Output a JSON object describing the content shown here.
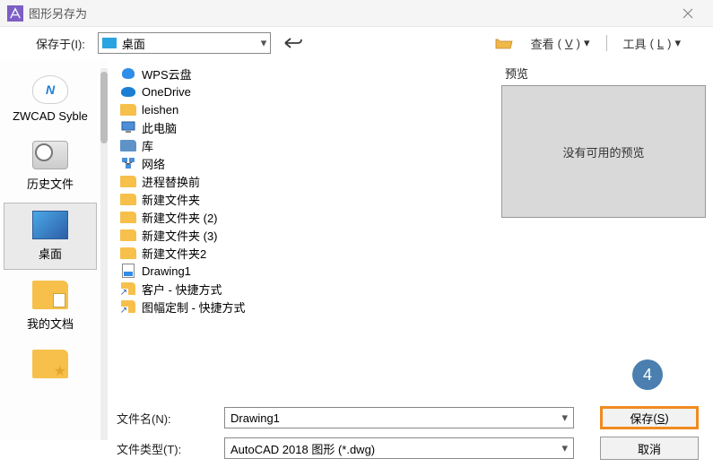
{
  "window": {
    "title": "图形另存为"
  },
  "toolbar": {
    "save_in_label": "保存于(I):",
    "location": "桌面",
    "view_label": "查看",
    "view_key": "V",
    "tools_label": "工具",
    "tools_key": "L"
  },
  "sidebar": {
    "items": [
      {
        "label": "ZWCAD Syble",
        "icon": "cloud"
      },
      {
        "label": "历史文件",
        "icon": "history"
      },
      {
        "label": "桌面",
        "icon": "desktop",
        "selected": true
      },
      {
        "label": "我的文档",
        "icon": "docs"
      },
      {
        "label": "",
        "icon": "fav"
      }
    ]
  },
  "files": [
    {
      "name": "WPS云盘",
      "icon": "wps"
    },
    {
      "name": "OneDrive",
      "icon": "onedrive"
    },
    {
      "name": "leishen",
      "icon": "folder"
    },
    {
      "name": "此电脑",
      "icon": "pc"
    },
    {
      "name": "库",
      "icon": "folder-blue"
    },
    {
      "name": "网络",
      "icon": "network"
    },
    {
      "name": "进程替换前",
      "icon": "folder"
    },
    {
      "name": "新建文件夹",
      "icon": "folder"
    },
    {
      "name": "新建文件夹 (2)",
      "icon": "folder"
    },
    {
      "name": "新建文件夹 (3)",
      "icon": "folder"
    },
    {
      "name": "新建文件夹2",
      "icon": "folder"
    },
    {
      "name": "Drawing1",
      "icon": "dwg"
    },
    {
      "name": "客户 - 快捷方式",
      "icon": "shortcut"
    },
    {
      "name": "图幅定制 - 快捷方式",
      "icon": "shortcut"
    }
  ],
  "preview": {
    "label": "预览",
    "empty_text": "没有可用的预览"
  },
  "form": {
    "name_label": "文件名(N):",
    "name_value": "Drawing1",
    "type_label": "文件类型(T):",
    "type_value": "AutoCAD 2018 图形 (*.dwg)"
  },
  "actions": {
    "save_label": "保存",
    "save_key": "S",
    "cancel_label": "取消"
  },
  "annotation": {
    "badge": "4"
  }
}
